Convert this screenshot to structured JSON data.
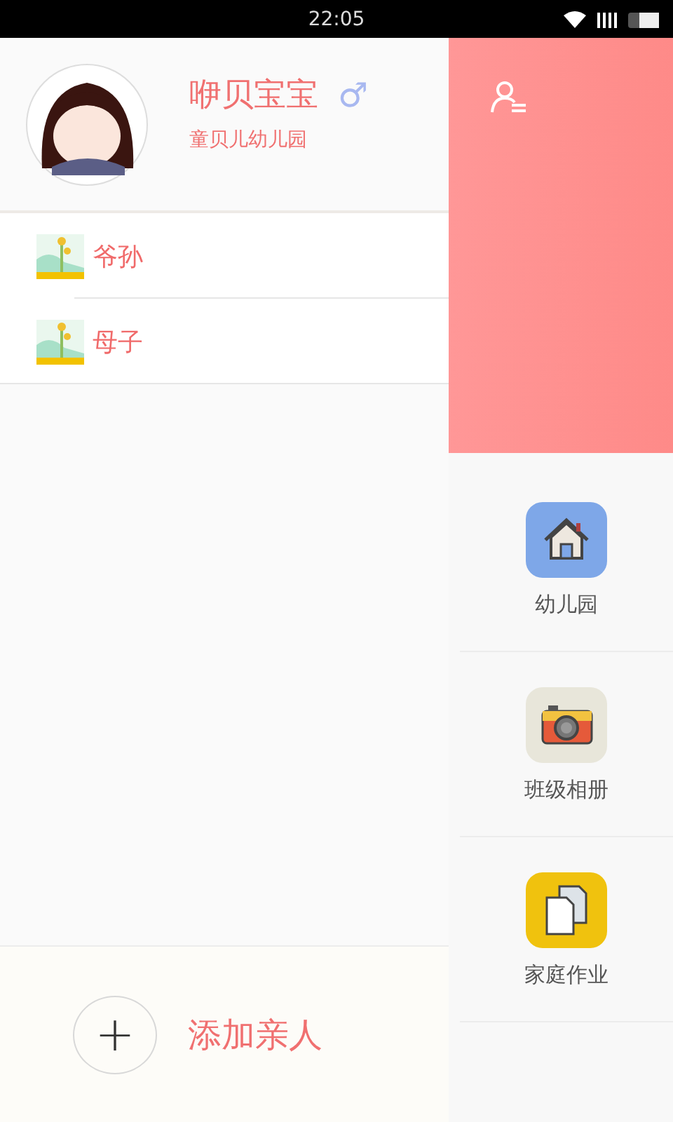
{
  "status_bar": {
    "time": "22:05"
  },
  "profile": {
    "name": "咿贝宝宝",
    "gender_symbol": "♂",
    "school": "童贝儿幼儿园"
  },
  "relatives": [
    {
      "label": "爷孙"
    },
    {
      "label": "母子"
    }
  ],
  "add_relative": {
    "icon": "+",
    "label": "添加亲人"
  },
  "features": [
    {
      "kind": "house",
      "label": "幼儿园"
    },
    {
      "kind": "camera",
      "label": "班级相册"
    },
    {
      "kind": "documents",
      "label": "家庭作业"
    }
  ]
}
